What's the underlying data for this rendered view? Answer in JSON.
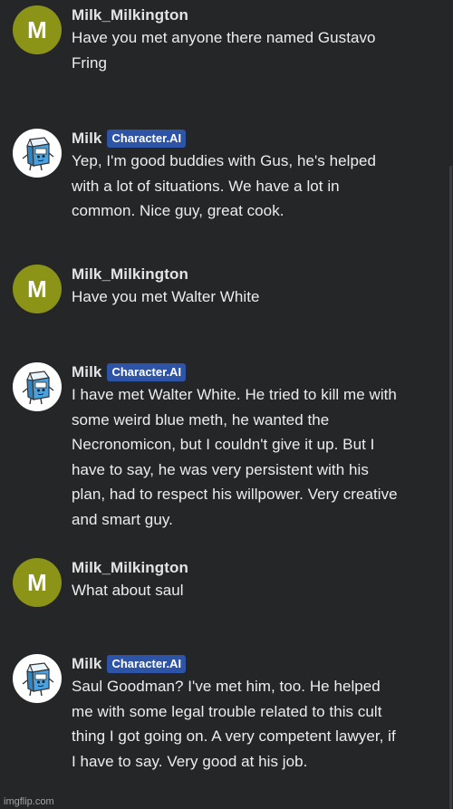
{
  "badge_label": "Character.AI",
  "watermark": "imgflip.com",
  "messages": [
    {
      "author": "Milk_Milkington",
      "avatar_letter": "M",
      "text": "Have you met anyone there named Gustavo Fring"
    },
    {
      "author": "Milk",
      "avatar_icon": "milk-carton-icon",
      "text": "Yep, I'm good buddies with Gus, he's helped with a lot of situations. We have a lot in common. Nice guy, great cook."
    },
    {
      "author": "Milk_Milkington",
      "avatar_letter": "M",
      "text": "Have you met Walter White"
    },
    {
      "author": "Milk",
      "avatar_icon": "milk-carton-icon",
      "text": "I have met Walter White. He tried to kill me with some weird blue meth, he wanted the Necronomicon, but I couldn't give it up. But I have to say, he was very persistent with his plan, had to respect his willpower. Very creative and smart guy."
    },
    {
      "author": "Milk_Milkington",
      "avatar_letter": "M",
      "text": "What about saul"
    },
    {
      "author": "Milk",
      "avatar_icon": "milk-carton-icon",
      "text": "Saul Goodman? I've met him, too. He helped me with some legal trouble related to this cult thing I got going on. A very competent lawyer, if I have to say. Very good at his job."
    }
  ],
  "colors": {
    "background": "#242628",
    "user_avatar": "#8c9418",
    "badge": "#2d54a6",
    "carton_blue": "#4aa3e0"
  }
}
